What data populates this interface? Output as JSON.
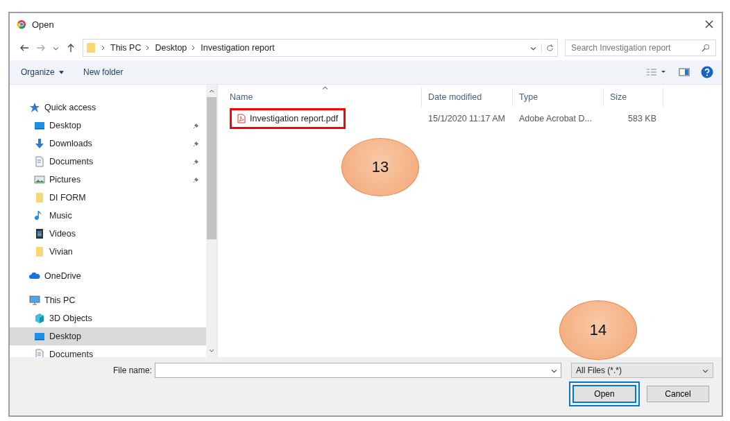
{
  "window": {
    "title": "Open"
  },
  "address": {
    "crumbs": [
      "This PC",
      "Desktop",
      "Investigation report"
    ]
  },
  "search": {
    "placeholder": "Search Investigation report"
  },
  "toolbar": {
    "organize": "Organize",
    "new_folder": "New folder"
  },
  "nav_pane": [
    {
      "label": "Quick access",
      "kind": "star",
      "selected": false,
      "children": [
        {
          "label": "Desktop",
          "kind": "desktop",
          "pinned": true,
          "selected": false
        },
        {
          "label": "Downloads",
          "kind": "downloads",
          "pinned": true,
          "selected": false
        },
        {
          "label": "Documents",
          "kind": "documents",
          "pinned": true,
          "selected": false
        },
        {
          "label": "Pictures",
          "kind": "pictures",
          "pinned": true,
          "selected": false
        },
        {
          "label": "DI FORM",
          "kind": "folder",
          "pinned": false,
          "selected": false
        },
        {
          "label": "Music",
          "kind": "music",
          "pinned": false,
          "selected": false
        },
        {
          "label": "Videos",
          "kind": "videos",
          "pinned": false,
          "selected": false
        },
        {
          "label": "Vivian",
          "kind": "folder",
          "pinned": false,
          "selected": false
        }
      ]
    },
    {
      "label": "OneDrive",
      "kind": "cloud",
      "selected": false
    },
    {
      "label": "This PC",
      "kind": "pc",
      "selected": false,
      "children": [
        {
          "label": "3D Objects",
          "kind": "objects3d",
          "pinned": false,
          "selected": false
        },
        {
          "label": "Desktop",
          "kind": "desktop",
          "pinned": false,
          "selected": true
        },
        {
          "label": "Documents",
          "kind": "documents",
          "pinned": false,
          "selected": false
        }
      ]
    }
  ],
  "columns": [
    "Name",
    "Date modified",
    "Type",
    "Size"
  ],
  "files": [
    {
      "name": "Investigation report.pdf",
      "date": "15/1/2020 11:17 AM",
      "type": "Adobe Acrobat D...",
      "size": "583 KB",
      "highlighted": true
    }
  ],
  "file_name": {
    "label": "File name:"
  },
  "filter": "All Files (*.*)",
  "buttons": [
    {
      "label": "Open",
      "kind": "primary",
      "highlighted": true
    },
    {
      "label": "Cancel",
      "kind": "normal",
      "highlighted": false
    }
  ],
  "callouts": [
    "13",
    "14"
  ]
}
